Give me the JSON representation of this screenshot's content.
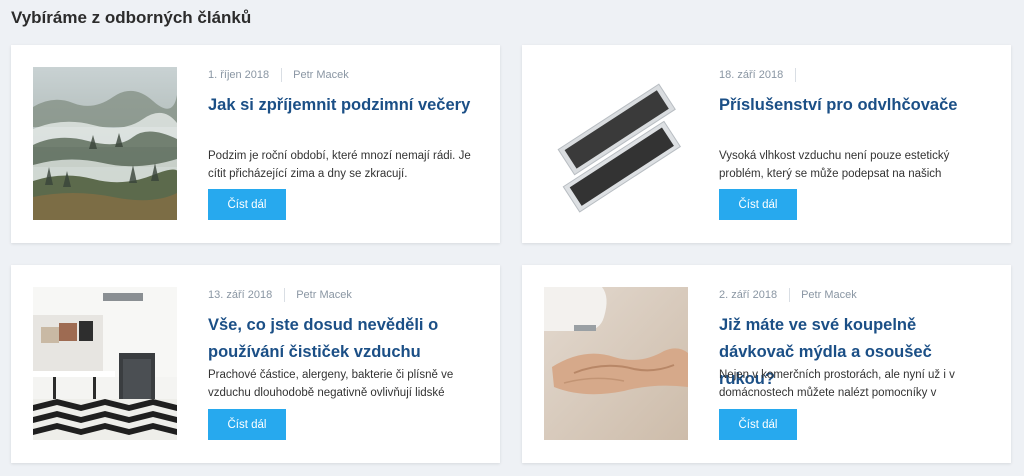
{
  "section": {
    "title": "Vybíráme z odborných článků"
  },
  "articles": [
    {
      "image_icon": "misty-forest-landscape-photo",
      "date": "1. říjen 2018",
      "author": "Petr Macek",
      "title": "Jak si zpříjemnit podzimní večery",
      "excerpt": "Podzim je roční období, které mnozí nemají rádi. Je cítit přicházející zima a dny se zkracují.",
      "button": "Číst dál"
    },
    {
      "image_icon": "dehumidifier-filters-photo",
      "date": "18. září 2018",
      "author": "",
      "title": "Příslušenství pro odvlhčovače",
      "excerpt": "Vysoká vlhkost vzduchu není pouze estetický problém, který se může podepsat na našich",
      "button": "Číst dál"
    },
    {
      "image_icon": "living-room-air-purifier-photo",
      "date": "13. září 2018",
      "author": "Petr Macek",
      "title": "Vše, co jste dosud nevěděli o používání čističek vzduchu",
      "excerpt": "Prachové částice, alergeny, bakterie či plísně ve vzduchu dlouhodobě negativně ovlivňují lidské",
      "button": "Číst dál"
    },
    {
      "image_icon": "hands-under-dispenser-photo",
      "date": "2. září 2018",
      "author": "Petr Macek",
      "title": "Již máte ve své koupelně dávkovač mýdla a osoušeč rukou?",
      "excerpt": "Nejen v komerčních prostorách, ale nyní už i v domácnostech můžete nalézt pomocníky v",
      "button": "Číst dál"
    }
  ],
  "colors": {
    "page_bg": "#eef1f5",
    "card_bg": "#ffffff",
    "title": "#1b4f86",
    "button": "#27a9ee",
    "meta": "#8a96a3"
  }
}
